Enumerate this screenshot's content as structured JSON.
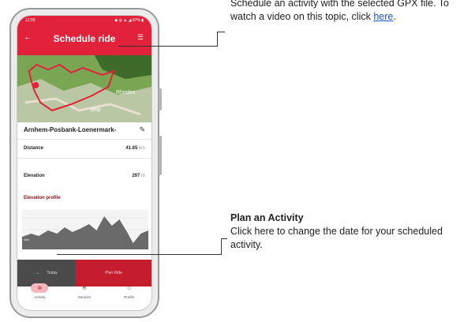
{
  "phone": {
    "status_time": "12:00",
    "status_icons": "◆ ◎ ▲ ◢ 97% ▮",
    "app_title": "Schedule ride",
    "back_icon": "arrow-left-icon",
    "menu_icon": "menu-icon",
    "map": {
      "labels": [
        "Velp",
        "Rheden"
      ]
    },
    "route_name": "Arnhem-Posbank-Loenermark-",
    "stats": [
      {
        "label": "Distance",
        "value": "41.65",
        "unit": "km"
      },
      {
        "label": "Elevation",
        "value": "297",
        "unit": "m"
      }
    ],
    "elevation_profile_label": "Elevation profile",
    "elevation_axis": [
      "80m",
      "60m",
      "40m"
    ],
    "buttons": {
      "today": "Today",
      "plan_ride": "Plan Ride"
    },
    "nav": [
      {
        "label": "Activity",
        "icon": "bike-icon",
        "active": true
      },
      {
        "label": "Sensors",
        "icon": "database-icon",
        "active": false
      },
      {
        "label": "Profile",
        "icon": "user-icon",
        "active": false
      }
    ]
  },
  "annotations": {
    "top": {
      "text_before_link": "Schedule an activity with the selected GPX file. To watch a video on this topic, click ",
      "link": "here",
      "text_after_link": "."
    },
    "bottom": {
      "heading": "Plan an Activity",
      "body": "Click here to change the date for your scheduled activity."
    }
  },
  "colors": {
    "brand_red": "#e2223a",
    "dark_button": "#4b4b4b",
    "link_blue": "#1a56c9"
  }
}
